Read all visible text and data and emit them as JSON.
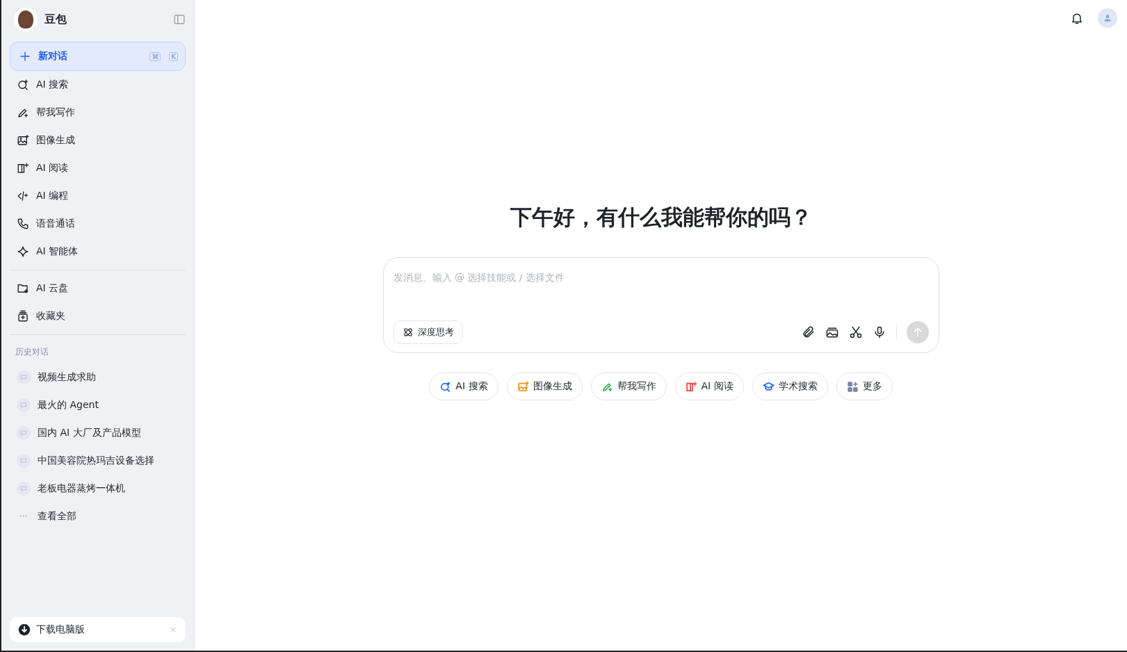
{
  "app": {
    "name": "豆包"
  },
  "new_chat": {
    "label": "新对话",
    "keys": [
      "⌘",
      "K"
    ]
  },
  "nav": [
    {
      "label": "AI 搜索"
    },
    {
      "label": "帮我写作"
    },
    {
      "label": "图像生成"
    },
    {
      "label": "AI 阅读"
    },
    {
      "label": "AI 编程"
    },
    {
      "label": "语音通话"
    },
    {
      "label": "AI 智能体"
    }
  ],
  "nav2": [
    {
      "label": "AI 云盘"
    },
    {
      "label": "收藏夹"
    }
  ],
  "history": {
    "title": "历史对话",
    "items": [
      "视频生成求助",
      "最火的 Agent",
      "国内 AI 大厂及产品模型",
      "中国美容院热玛吉设备选择",
      "老板电器蒸烤一体机"
    ],
    "more": {
      "icon": "···",
      "label": "查看全部"
    }
  },
  "download": {
    "label": "下载电脑版"
  },
  "greeting": "下午好，有什么我能帮你的吗？",
  "composer": {
    "placeholder": "发消息、输入 @ 选择技能或 / 选择文件",
    "deep_think": "深度思考"
  },
  "chips": [
    {
      "label": "AI 搜索",
      "color": "#1f6bff"
    },
    {
      "label": "图像生成",
      "color": "#f5931f"
    },
    {
      "label": "帮我写作",
      "color": "#2fb34a"
    },
    {
      "label": "AI 阅读",
      "color": "#f5403d"
    },
    {
      "label": "学术搜索",
      "color": "#1f6bff"
    },
    {
      "label": "更多",
      "color": "#7d85a8"
    }
  ]
}
